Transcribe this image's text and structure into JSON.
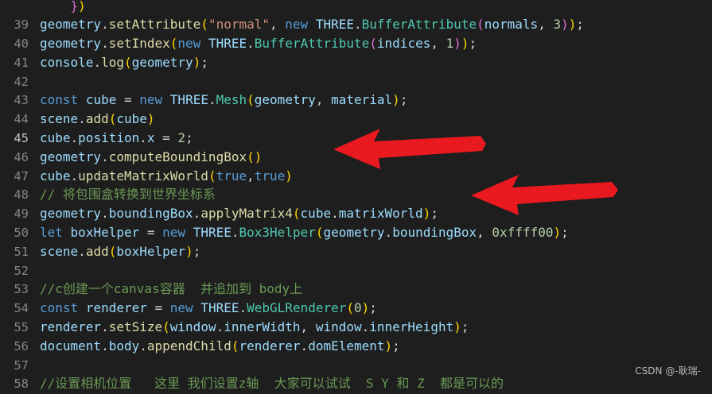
{
  "editor": {
    "lines": [
      {
        "n": "",
        "tokens": [
          {
            "t": "    ",
            "c": "pn"
          },
          {
            "t": "}",
            "c": "br2"
          },
          {
            "t": ")",
            "c": "br1"
          }
        ]
      },
      {
        "n": "39",
        "tokens": [
          {
            "t": "geometry",
            "c": "var"
          },
          {
            "t": ".",
            "c": "pn"
          },
          {
            "t": "setAttribute",
            "c": "fn"
          },
          {
            "t": "(",
            "c": "br1"
          },
          {
            "t": "\"normal\"",
            "c": "str"
          },
          {
            "t": ", ",
            "c": "pn"
          },
          {
            "t": "new",
            "c": "kw"
          },
          {
            "t": " ",
            "c": "pn"
          },
          {
            "t": "THREE",
            "c": "var"
          },
          {
            "t": ".",
            "c": "pn"
          },
          {
            "t": "BufferAttribute",
            "c": "cls"
          },
          {
            "t": "(",
            "c": "br2"
          },
          {
            "t": "normals",
            "c": "var"
          },
          {
            "t": ", ",
            "c": "pn"
          },
          {
            "t": "3",
            "c": "num"
          },
          {
            "t": ")",
            "c": "br2"
          },
          {
            "t": ")",
            "c": "br1"
          },
          {
            "t": ";",
            "c": "pn"
          }
        ]
      },
      {
        "n": "40",
        "tokens": [
          {
            "t": "geometry",
            "c": "var"
          },
          {
            "t": ".",
            "c": "pn"
          },
          {
            "t": "setIndex",
            "c": "fn"
          },
          {
            "t": "(",
            "c": "br1"
          },
          {
            "t": "new",
            "c": "kw"
          },
          {
            "t": " ",
            "c": "pn"
          },
          {
            "t": "THREE",
            "c": "var"
          },
          {
            "t": ".",
            "c": "pn"
          },
          {
            "t": "BufferAttribute",
            "c": "cls"
          },
          {
            "t": "(",
            "c": "br2"
          },
          {
            "t": "indices",
            "c": "var"
          },
          {
            "t": ", ",
            "c": "pn"
          },
          {
            "t": "1",
            "c": "num"
          },
          {
            "t": ")",
            "c": "br2"
          },
          {
            "t": ")",
            "c": "br1"
          },
          {
            "t": ";",
            "c": "pn"
          }
        ]
      },
      {
        "n": "41",
        "tokens": [
          {
            "t": "console",
            "c": "var"
          },
          {
            "t": ".",
            "c": "pn"
          },
          {
            "t": "log",
            "c": "fn"
          },
          {
            "t": "(",
            "c": "br1"
          },
          {
            "t": "geometry",
            "c": "var"
          },
          {
            "t": ")",
            "c": "br1"
          },
          {
            "t": ";",
            "c": "pn"
          }
        ]
      },
      {
        "n": "42",
        "tokens": []
      },
      {
        "n": "43",
        "tokens": [
          {
            "t": "const",
            "c": "kw"
          },
          {
            "t": " ",
            "c": "pn"
          },
          {
            "t": "cube",
            "c": "var"
          },
          {
            "t": " = ",
            "c": "pn"
          },
          {
            "t": "new",
            "c": "kw"
          },
          {
            "t": " ",
            "c": "pn"
          },
          {
            "t": "THREE",
            "c": "var"
          },
          {
            "t": ".",
            "c": "pn"
          },
          {
            "t": "Mesh",
            "c": "cls"
          },
          {
            "t": "(",
            "c": "br1"
          },
          {
            "t": "geometry",
            "c": "var"
          },
          {
            "t": ", ",
            "c": "pn"
          },
          {
            "t": "material",
            "c": "var"
          },
          {
            "t": ")",
            "c": "br1"
          },
          {
            "t": ";",
            "c": "pn"
          }
        ]
      },
      {
        "n": "44",
        "tokens": [
          {
            "t": "scene",
            "c": "var"
          },
          {
            "t": ".",
            "c": "pn"
          },
          {
            "t": "add",
            "c": "fn"
          },
          {
            "t": "(",
            "c": "br1"
          },
          {
            "t": "cube",
            "c": "var"
          },
          {
            "t": ")",
            "c": "br1"
          }
        ]
      },
      {
        "n": "45",
        "active": true,
        "tokens": [
          {
            "t": "cube",
            "c": "var"
          },
          {
            "t": ".",
            "c": "pn"
          },
          {
            "t": "position",
            "c": "var"
          },
          {
            "t": ".",
            "c": "pn"
          },
          {
            "t": "x",
            "c": "var"
          },
          {
            "t": " = ",
            "c": "pn"
          },
          {
            "t": "2",
            "c": "num"
          },
          {
            "t": ";",
            "c": "pn"
          }
        ]
      },
      {
        "n": "46",
        "tokens": [
          {
            "t": "geometry",
            "c": "var"
          },
          {
            "t": ".",
            "c": "pn"
          },
          {
            "t": "computeBoundingBox",
            "c": "fn"
          },
          {
            "t": "(",
            "c": "br1"
          },
          {
            "t": ")",
            "c": "br1"
          }
        ]
      },
      {
        "n": "47",
        "tokens": [
          {
            "t": "cube",
            "c": "var"
          },
          {
            "t": ".",
            "c": "pn"
          },
          {
            "t": "updateMatrixWorld",
            "c": "fn"
          },
          {
            "t": "(",
            "c": "br1"
          },
          {
            "t": "true",
            "c": "kw"
          },
          {
            "t": ",",
            "c": "pn"
          },
          {
            "t": "true",
            "c": "kw"
          },
          {
            "t": ")",
            "c": "br1"
          }
        ]
      },
      {
        "n": "48",
        "tokens": [
          {
            "t": "// 将包围盒转换到世界坐标系",
            "c": "cm"
          }
        ]
      },
      {
        "n": "49",
        "tokens": [
          {
            "t": "geometry",
            "c": "var"
          },
          {
            "t": ".",
            "c": "pn"
          },
          {
            "t": "boundingBox",
            "c": "var"
          },
          {
            "t": ".",
            "c": "pn"
          },
          {
            "t": "applyMatrix4",
            "c": "fn"
          },
          {
            "t": "(",
            "c": "br1"
          },
          {
            "t": "cube",
            "c": "var"
          },
          {
            "t": ".",
            "c": "pn"
          },
          {
            "t": "matrixWorld",
            "c": "var"
          },
          {
            "t": ")",
            "c": "br1"
          },
          {
            "t": ";",
            "c": "pn"
          }
        ]
      },
      {
        "n": "50",
        "tokens": [
          {
            "t": "let",
            "c": "kw"
          },
          {
            "t": " ",
            "c": "pn"
          },
          {
            "t": "boxHelper",
            "c": "var"
          },
          {
            "t": " = ",
            "c": "pn"
          },
          {
            "t": "new",
            "c": "kw"
          },
          {
            "t": " ",
            "c": "pn"
          },
          {
            "t": "THREE",
            "c": "var"
          },
          {
            "t": ".",
            "c": "pn"
          },
          {
            "t": "Box3Helper",
            "c": "cls"
          },
          {
            "t": "(",
            "c": "br1"
          },
          {
            "t": "geometry",
            "c": "var"
          },
          {
            "t": ".",
            "c": "pn"
          },
          {
            "t": "boundingBox",
            "c": "var"
          },
          {
            "t": ", ",
            "c": "pn"
          },
          {
            "t": "0xffff00",
            "c": "num"
          },
          {
            "t": ")",
            "c": "br1"
          },
          {
            "t": ";",
            "c": "pn"
          }
        ]
      },
      {
        "n": "51",
        "tokens": [
          {
            "t": "scene",
            "c": "var"
          },
          {
            "t": ".",
            "c": "pn"
          },
          {
            "t": "add",
            "c": "fn"
          },
          {
            "t": "(",
            "c": "br1"
          },
          {
            "t": "boxHelper",
            "c": "var"
          },
          {
            "t": ")",
            "c": "br1"
          },
          {
            "t": ";",
            "c": "pn"
          }
        ]
      },
      {
        "n": "52",
        "tokens": []
      },
      {
        "n": "53",
        "tokens": [
          {
            "t": "//c创建一个canvas容器  并追加到 body上",
            "c": "cm"
          }
        ]
      },
      {
        "n": "54",
        "tokens": [
          {
            "t": "const",
            "c": "kw"
          },
          {
            "t": " ",
            "c": "pn"
          },
          {
            "t": "renderer",
            "c": "var"
          },
          {
            "t": " = ",
            "c": "pn"
          },
          {
            "t": "new",
            "c": "kw"
          },
          {
            "t": " ",
            "c": "pn"
          },
          {
            "t": "THREE",
            "c": "var"
          },
          {
            "t": ".",
            "c": "pn"
          },
          {
            "t": "WebGLRenderer",
            "c": "cls"
          },
          {
            "t": "(",
            "c": "br1"
          },
          {
            "t": "0",
            "c": "num"
          },
          {
            "t": ")",
            "c": "br1"
          },
          {
            "t": ";",
            "c": "pn"
          }
        ]
      },
      {
        "n": "55",
        "tokens": [
          {
            "t": "renderer",
            "c": "var"
          },
          {
            "t": ".",
            "c": "pn"
          },
          {
            "t": "setSize",
            "c": "fn"
          },
          {
            "t": "(",
            "c": "br1"
          },
          {
            "t": "window",
            "c": "var"
          },
          {
            "t": ".",
            "c": "pn"
          },
          {
            "t": "innerWidth",
            "c": "var"
          },
          {
            "t": ", ",
            "c": "pn"
          },
          {
            "t": "window",
            "c": "var"
          },
          {
            "t": ".",
            "c": "pn"
          },
          {
            "t": "innerHeight",
            "c": "var"
          },
          {
            "t": ")",
            "c": "br1"
          },
          {
            "t": ";",
            "c": "pn"
          }
        ]
      },
      {
        "n": "56",
        "tokens": [
          {
            "t": "document",
            "c": "var"
          },
          {
            "t": ".",
            "c": "pn"
          },
          {
            "t": "body",
            "c": "var"
          },
          {
            "t": ".",
            "c": "pn"
          },
          {
            "t": "appendChild",
            "c": "fn"
          },
          {
            "t": "(",
            "c": "br1"
          },
          {
            "t": "renderer",
            "c": "var"
          },
          {
            "t": ".",
            "c": "pn"
          },
          {
            "t": "domElement",
            "c": "var"
          },
          {
            "t": ")",
            "c": "br1"
          },
          {
            "t": ";",
            "c": "pn"
          }
        ]
      },
      {
        "n": "57",
        "tokens": []
      },
      {
        "n": "58",
        "tokens": [
          {
            "t": "//设置相机位置   这里 我们设置z轴  大家可以试试  S Y 和 Z  都是可以的",
            "c": "cm"
          }
        ]
      }
    ]
  },
  "annotations": {
    "arrow_color": "#e8191f"
  },
  "watermark": "CSDN @-耿瑞-"
}
